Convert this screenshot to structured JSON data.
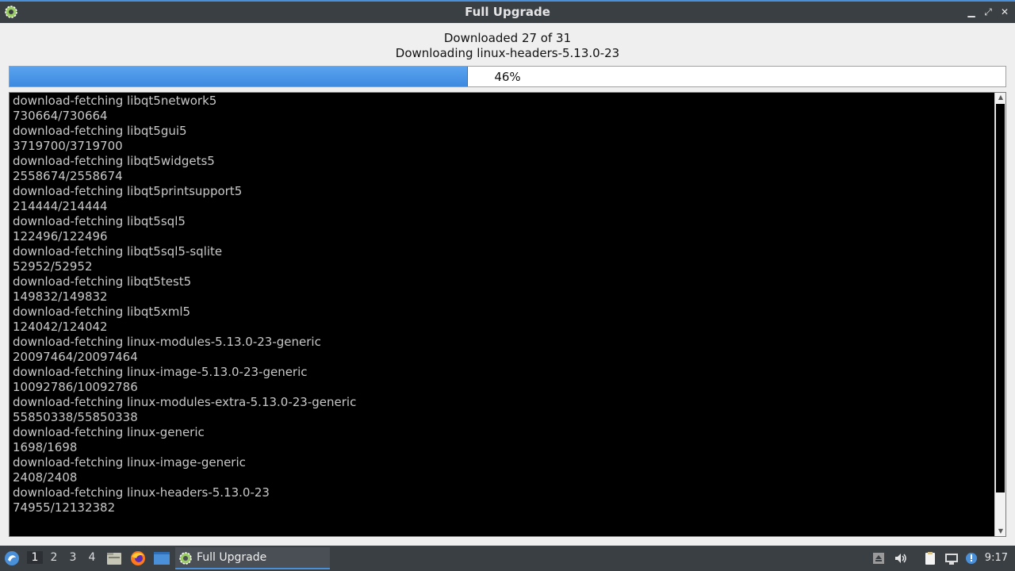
{
  "window": {
    "title": "Full Upgrade",
    "icon": "gear-icon",
    "controls": [
      "minimize-icon",
      "maximize-icon",
      "close-icon"
    ]
  },
  "status": {
    "downloaded": "Downloaded 27 of 31",
    "current": "Downloading linux-headers-5.13.0-23"
  },
  "progress": {
    "value": 0.46,
    "label": "46%",
    "fill_color": "#4a97e8"
  },
  "log": [
    "download-fetching libqt5network5",
    "730664/730664",
    "download-fetching libqt5gui5",
    "3719700/3719700",
    "download-fetching libqt5widgets5",
    "2558674/2558674",
    "download-fetching libqt5printsupport5",
    "214444/214444",
    "download-fetching libqt5sql5",
    "122496/122496",
    "download-fetching libqt5sql5-sqlite",
    "52952/52952",
    "download-fetching libqt5test5",
    "149832/149832",
    "download-fetching libqt5xml5",
    "124042/124042",
    "download-fetching linux-modules-5.13.0-23-generic",
    "20097464/20097464",
    "download-fetching linux-image-5.13.0-23-generic",
    "10092786/10092786",
    "download-fetching linux-modules-extra-5.13.0-23-generic",
    "55850338/55850338",
    "download-fetching linux-generic",
    "1698/1698",
    "download-fetching linux-image-generic",
    "2408/2408",
    "download-fetching linux-headers-5.13.0-23",
    "74955/12132382"
  ],
  "taskbar": {
    "workspaces": [
      "1",
      "2",
      "3",
      "4"
    ],
    "active_workspace": "1",
    "launchers": [
      "file-manager-icon",
      "firefox-icon",
      "desktop-icon"
    ],
    "task_label": "Full Upgrade",
    "tray": [
      "eject-icon",
      "volume-icon",
      "clipboard-icon",
      "network-icon",
      "notification-icon"
    ],
    "clock": "9:17"
  },
  "colors": {
    "titlebar": "#3a3f44",
    "accent": "#4a90d9",
    "terminal_bg": "#000000",
    "terminal_fg": "#c8c8c8"
  }
}
